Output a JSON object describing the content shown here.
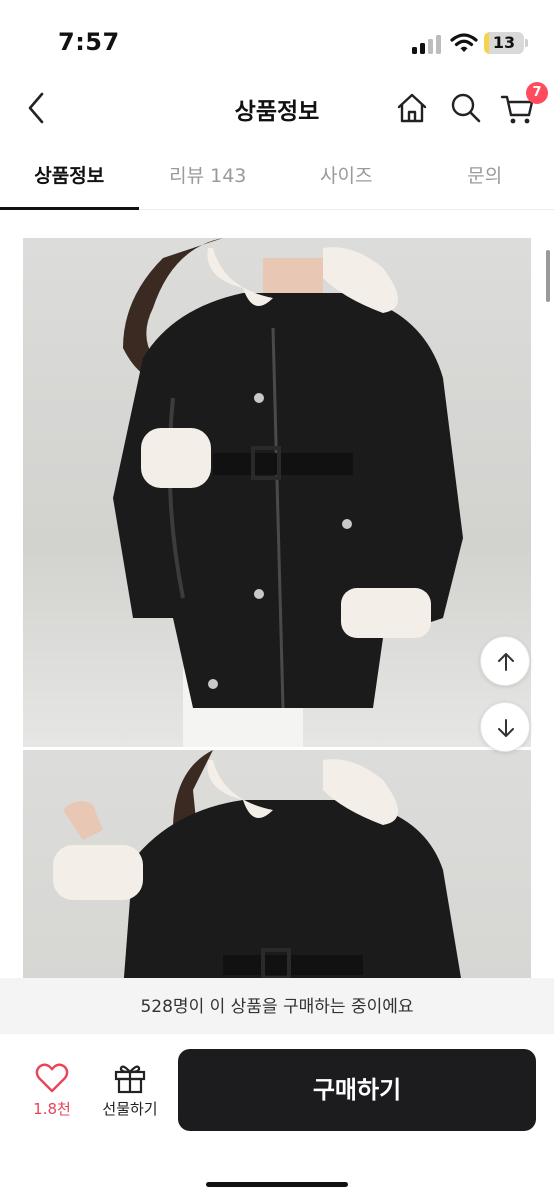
{
  "status_bar": {
    "time": "7:57",
    "battery_level": "13",
    "battery_percent": 13,
    "icons": [
      "signal-icon",
      "wifi-icon",
      "battery-icon"
    ]
  },
  "header": {
    "title": "상품정보",
    "cart_count": "7",
    "icons": [
      "back-arrow-icon",
      "home-icon",
      "search-icon",
      "cart-icon"
    ]
  },
  "tabs": [
    {
      "label": "상품정보",
      "active": true
    },
    {
      "label": "리뷰 143",
      "active": false
    },
    {
      "label": "사이즈",
      "active": false
    },
    {
      "label": "문의",
      "active": false
    }
  ],
  "scroll_buttons": {
    "icons": [
      "arrow-up-icon",
      "arrow-down-icon"
    ]
  },
  "purchase_notice": "528명이 이 상품을 구매하는 중이에요",
  "bottom_bar": {
    "like_count": "1.8천",
    "gift_label": "선물하기",
    "buy_label": "구매하기",
    "icons": [
      "heart-icon",
      "gift-icon"
    ]
  },
  "colors": {
    "accent": "#e8455a",
    "badge": "#ff4b5c",
    "buy_button": "#1c1c1e",
    "notice_background": "#f4f4f5"
  }
}
